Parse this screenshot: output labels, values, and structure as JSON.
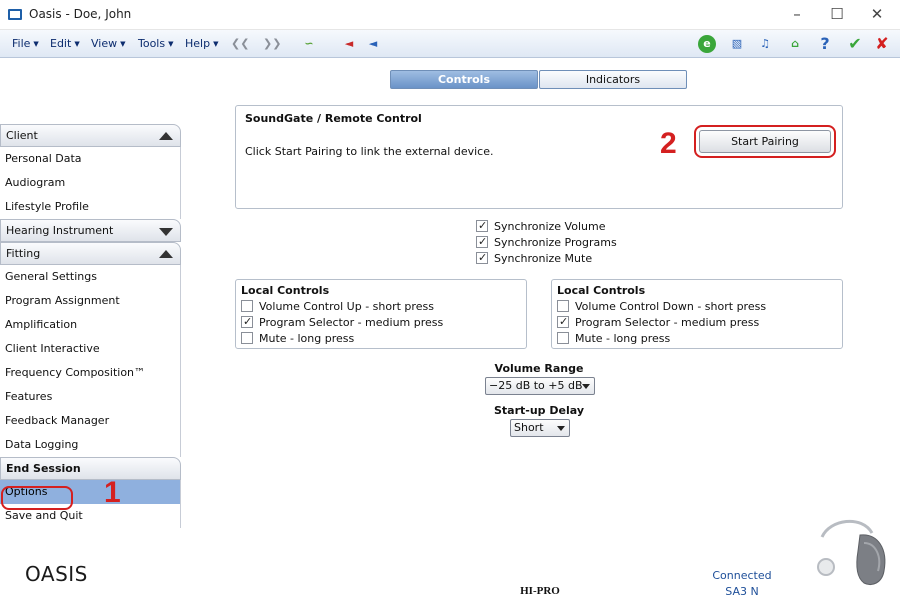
{
  "window": {
    "title": "Oasis - Doe, John"
  },
  "menu": [
    {
      "label": "File"
    },
    {
      "label": "Edit"
    },
    {
      "label": "View"
    },
    {
      "label": "Tools"
    },
    {
      "label": "Help"
    }
  ],
  "tabs": {
    "controls": "Controls",
    "indicators": "Indicators"
  },
  "sidebar": {
    "client": {
      "header": "Client",
      "items": [
        "Personal Data",
        "Audiogram",
        "Lifestyle Profile"
      ]
    },
    "hearing_instrument": {
      "header": "Hearing Instrument"
    },
    "fitting": {
      "header": "Fitting",
      "items": [
        "General Settings",
        "Program Assignment",
        "Amplification",
        "Client Interactive",
        "Frequency Composition™",
        "Features",
        "Feedback Manager",
        "Data Logging"
      ]
    },
    "end_session": {
      "header": "End Session",
      "items": [
        "Options",
        "Save and Quit"
      ]
    }
  },
  "brand": "OASIS",
  "soundgate": {
    "title": "SoundGate / Remote Control",
    "text": "Click Start Pairing to link the external device.",
    "button": "Start Pairing"
  },
  "sync": [
    {
      "label": "Synchronize Volume",
      "checked": true
    },
    {
      "label": "Synchronize Programs",
      "checked": true
    },
    {
      "label": "Synchronize Mute",
      "checked": true
    }
  ],
  "local_left": {
    "title": "Local Controls",
    "items": [
      {
        "label": "Volume Control Up - short press",
        "checked": false
      },
      {
        "label": "Program Selector - medium press",
        "checked": true
      },
      {
        "label": "Mute - long press",
        "checked": false
      }
    ]
  },
  "local_right": {
    "title": "Local Controls",
    "items": [
      {
        "label": "Volume Control Down - short press",
        "checked": false
      },
      {
        "label": "Program Selector - medium press",
        "checked": true
      },
      {
        "label": "Mute - long press",
        "checked": false
      }
    ]
  },
  "volume_range": {
    "label": "Volume Range",
    "value": "−25 dB to +5 dB"
  },
  "startup_delay": {
    "label": "Start-up Delay",
    "value": "Short"
  },
  "annotations": {
    "one": "1",
    "two": "2"
  },
  "footer": {
    "programmer": "HI-PRO",
    "status": "Connected",
    "device": "SA3 N"
  },
  "colors": {
    "accent": "#6a93c8",
    "annotation": "#d42020",
    "status_text": "#1e4f99"
  }
}
